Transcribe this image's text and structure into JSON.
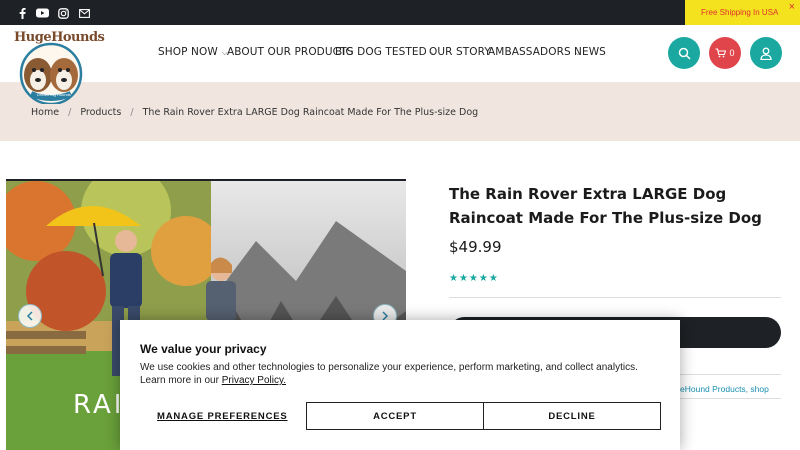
{
  "promo": {
    "text": "Free Shipping In USA",
    "close": "×"
  },
  "logo": {
    "wordmark": "HugeHounds",
    "tagline": "Dream Big Hounds"
  },
  "nav": [
    {
      "label": "SHOP NOW",
      "dropdown": true
    },
    {
      "label": "ABOUT OUR PRODUCTS",
      "dropdown": false
    },
    {
      "label": "BIG DOG TESTED",
      "dropdown": true
    },
    {
      "label": "OUR STORY",
      "dropdown": false
    },
    {
      "label": "AMBASSADORS",
      "dropdown": true
    },
    {
      "label": "NEWS",
      "dropdown": false
    }
  ],
  "header_actions": {
    "cart_count": "0"
  },
  "breadcrumb": {
    "home": "Home",
    "products": "Products",
    "current": "The Rain Rover Extra LARGE Dog Raincoat Made For The Plus-size Dog",
    "separator": "/"
  },
  "product": {
    "image_caption": "RAI",
    "title": "The Rain Rover Extra LARGE Dog Raincoat Made For The Plus-size Dog",
    "price": "$49.99",
    "rating_stars": "★★★★★",
    "meta_links": "eHound Products, shop"
  },
  "cookie": {
    "title": "We value your privacy",
    "body": "We use cookies and other technologies to personalize your experience, perform marketing, and collect analytics. Learn more in our ",
    "link": "Privacy Policy.",
    "manage": "MANAGE PREFERENCES",
    "accept": "ACCEPT",
    "decline": "DECLINE"
  },
  "colors": {
    "topbar": "#1e2125",
    "promo_bg": "#f4e21e",
    "teal": "#1aa8a0",
    "cart_red": "#e0454b",
    "crumb_band": "#f1e6df"
  },
  "icons": [
    "facebook-icon",
    "youtube-icon",
    "instagram-icon",
    "email-icon",
    "search-icon",
    "cart-icon",
    "account-icon",
    "chevron-left-icon",
    "chevron-right-icon"
  ]
}
